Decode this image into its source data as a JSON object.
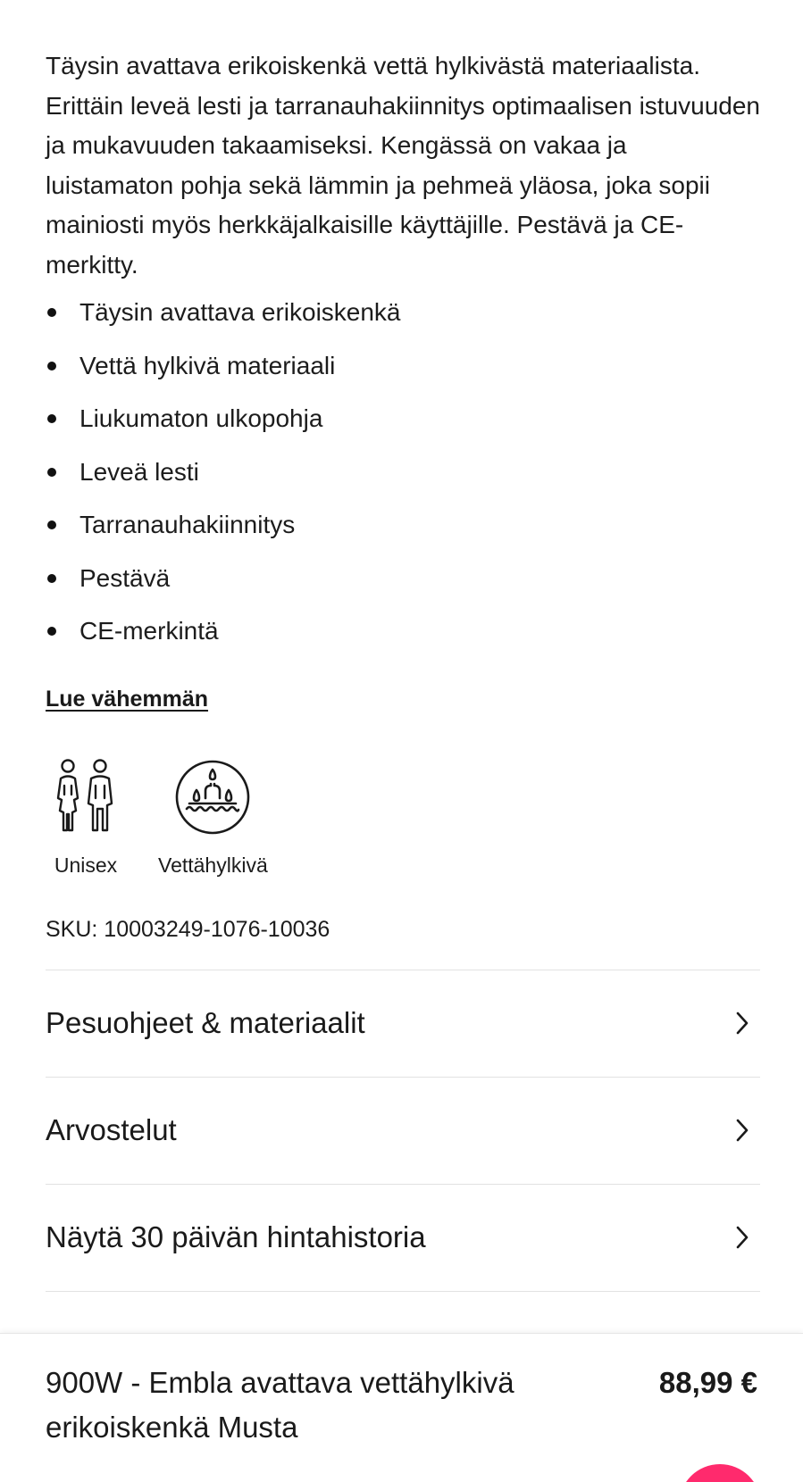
{
  "description": "Täysin avattava erikoiskenkä vettä hylkivästä materiaalista. Erittäin leveä lesti ja tarranauhakiinnitys optimaalisen istuvuuden ja mukavuuden takaamiseksi. Kengässä on vakaa ja luistamaton pohja sekä lämmin ja pehmeä yläosa, joka sopii mainiosti myös herkkäjalkaisille käyttäjille. Pestävä ja CE-merkitty.",
  "features": [
    "Täysin avattava erikoiskenkä",
    "Vettä hylkivä materiaali",
    "Liukumaton ulkopohja",
    "Leveä lesti",
    "Tarranauhakiinnitys",
    "Pestävä",
    "CE-merkintä"
  ],
  "read_less_label": "Lue vähemmän",
  "badges": [
    {
      "icon": "unisex-icon",
      "label": "Unisex"
    },
    {
      "icon": "water-repellent-icon",
      "label": "Vettähylkivä"
    }
  ],
  "sku": "SKU: 10003249-1076-10036",
  "accordion": [
    {
      "label": "Pesuohjeet & materiaalit"
    },
    {
      "label": "Arvostelut"
    },
    {
      "label": "Näytä 30 päivän hintahistoria"
    }
  ],
  "bottom_bar": {
    "product_name": "900W - Embla avattava vettähylkivä erikoiskenkä Musta",
    "price": "88,99 €"
  },
  "colors": {
    "accent": "#ff2a6d",
    "text": "#1a1a1a",
    "divider": "#e2e2e2"
  }
}
